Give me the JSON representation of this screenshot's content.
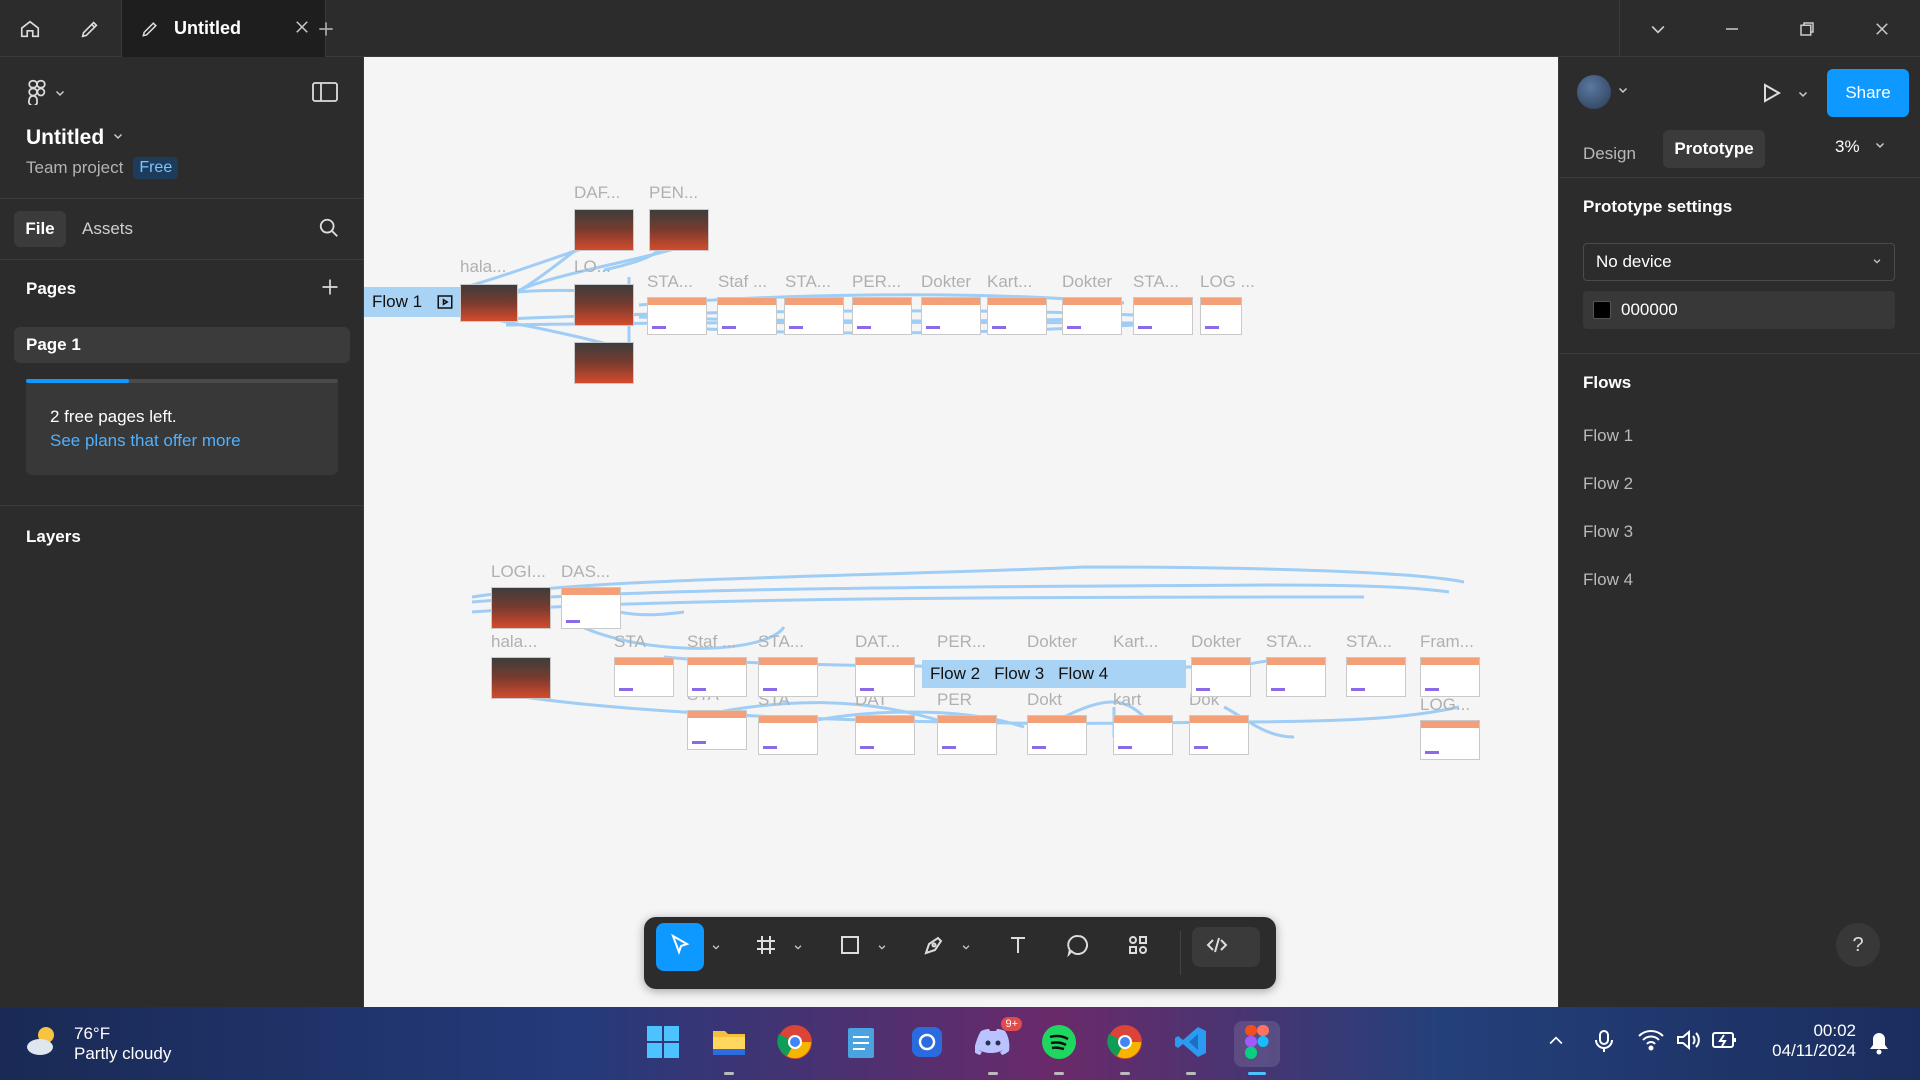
{
  "tabbar": {
    "tab_title": "Untitled"
  },
  "left_panel": {
    "file_title": "Untitled",
    "team_label": "Team project",
    "plan_badge": "Free",
    "tabs": [
      "File",
      "Assets"
    ],
    "pages_heading": "Pages",
    "page_item": "Page 1",
    "pages_notice": "2 free pages left.",
    "pages_link": "See plans that offer more",
    "pages_used_fraction": 0.33,
    "layers_heading": "Layers"
  },
  "right_panel": {
    "share_label": "Share",
    "mode_tabs": [
      "Design",
      "Prototype"
    ],
    "active_mode": "Prototype",
    "zoom": "3%",
    "settings_heading": "Prototype settings",
    "device_select": "No device",
    "background_hex": "000000",
    "flows_heading": "Flows",
    "flows": [
      "Flow 1",
      "Flow 2",
      "Flow 3",
      "Flow 4"
    ]
  },
  "canvas": {
    "flow_tags": [
      "Flow 1",
      "Flow 2",
      "Flow 3",
      "Flow 4"
    ],
    "frame_labels_top": [
      "DAF...",
      "PEN...",
      "hala...",
      "LO...",
      "STA...",
      "Staf ...",
      "STA...",
      "PER...",
      "Dokter",
      "Kart...",
      "Dokter",
      "STA...",
      "LOG ..."
    ],
    "frame_labels_bottom": [
      "LOGI...",
      "DAS...",
      "hala...",
      "STA",
      "Staf ...",
      "STA...",
      "DAT...",
      "PER...",
      "Dokter",
      "Kart...",
      "Dokter",
      "STA...",
      "STA...",
      "Fram...",
      "STA",
      "STA",
      "DAT",
      "PER",
      "Dokt",
      "kart",
      "Dok",
      "LOG..."
    ]
  },
  "taskbar": {
    "temperature": "76°F",
    "weather": "Partly cloudy",
    "time": "00:02",
    "date": "04/11/2024",
    "discord_badge": "9+"
  },
  "colors": {
    "accent": "#0d99ff",
    "flow_line": "#9fcdf5",
    "canvas_bg": "#f5f5f5",
    "panel_bg": "#2c2c2c"
  }
}
